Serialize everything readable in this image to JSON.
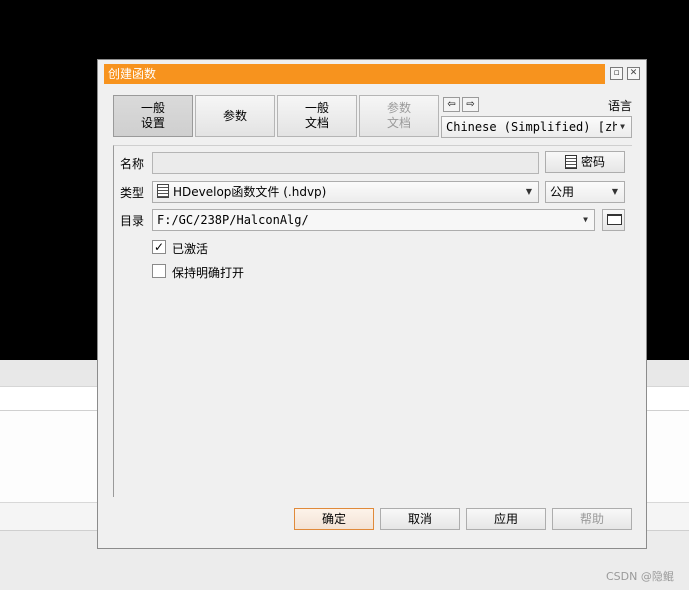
{
  "dialog": {
    "title": "创建函数",
    "window_buttons": [
      "restore-icon",
      "close-icon"
    ],
    "tabs": [
      {
        "label_line1": "一般",
        "label_line2": "设置",
        "state": "active"
      },
      {
        "label_line1": "参数",
        "label_line2": "",
        "state": "normal"
      },
      {
        "label_line1": "一般",
        "label_line2": "文档",
        "state": "normal"
      },
      {
        "label_line1": "参数",
        "label_line2": "文档",
        "state": "disabled"
      }
    ],
    "nav": {
      "prev_glyph": "⇦",
      "next_glyph": "⇨"
    },
    "language": {
      "label": "语言",
      "value": "Chinese (Simplified) [zh"
    },
    "form": {
      "name_label": "名称",
      "name_value": "",
      "password_button": "密码",
      "type_label": "类型",
      "type_value": "HDevelop函数文件 (.hdvp)",
      "scope_value": "公用",
      "dir_label": "目录",
      "dir_value": "F:/GC/238P/HalconAlg/",
      "activated_label": "已激活",
      "activated_checked": true,
      "keep_open_label": "保持明确打开",
      "keep_open_checked": false
    },
    "footer": {
      "ok": "确定",
      "cancel": "取消",
      "apply": "应用",
      "help": "帮助"
    }
  },
  "background": {
    "watermark": "CSDN @隐鲲"
  },
  "colors": {
    "title_bar": "#f7931e",
    "desktop": "#000000",
    "dialog_bg": "#f0f0f0"
  }
}
